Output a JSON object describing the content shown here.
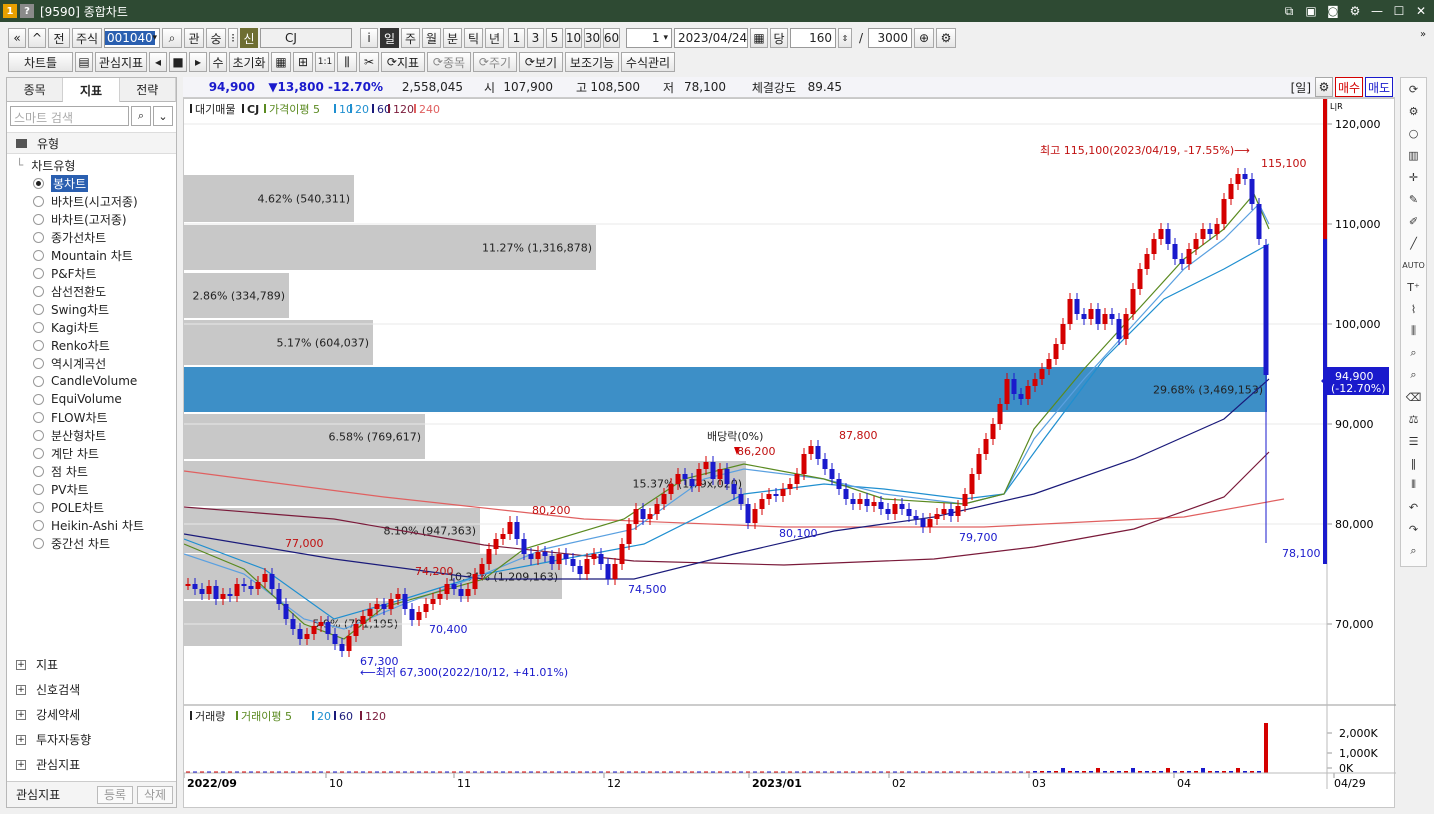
{
  "window": {
    "title": "[9590] 종합차트",
    "badge1": "1",
    "badge2": "?"
  },
  "toolbar1": {
    "nav_first": "«",
    "nav_up": "^",
    "prev": "전",
    "market": "주식",
    "code": "001040",
    "mag": "⌕",
    "rel": "관",
    "sort": "숭",
    "sep": "⁝",
    "new_badge": "신",
    "name": "CJ",
    "info": "i",
    "periods": [
      "일",
      "주",
      "월",
      "분",
      "틱",
      "년"
    ],
    "mins": [
      "1",
      "3",
      "5",
      "10",
      "30",
      "60"
    ],
    "unit": "1",
    "date": "2023/04/24",
    "dang": "당",
    "count": "160",
    "slash": "/",
    "total": "3000"
  },
  "toolbar2": {
    "chart_type": "차트틀",
    "interest": "관심지표",
    "su": "수",
    "reset": "초기화",
    "bong": "1:1",
    "indicator": "지표",
    "item": "종목",
    "period_btn": "주기",
    "view": "보기",
    "aux": "보조기능",
    "formula": "수식관리"
  },
  "left": {
    "tabs": [
      "종목",
      "지표",
      "전략"
    ],
    "search_placeholder": "스마트 검색",
    "section": "유형",
    "group": "차트유형",
    "items": [
      "봉차트",
      "바차트(시고저종)",
      "바차트(고저종)",
      "종가선차트",
      "Mountain 차트",
      "P&F차트",
      "삼선전환도",
      "Swing차트",
      "Kagi차트",
      "Renko차트",
      "역시계곡선",
      "CandleVolume",
      "EquiVolume",
      "FLOW차트",
      "분산형차트",
      "계단 차트",
      "점 차트",
      "PV차트",
      "POLE차트",
      "Heikin-Ashi 차트",
      "중간선 차트"
    ],
    "bottom": [
      "지표",
      "신호검색",
      "강세약세",
      "투자자동향",
      "관심지표"
    ],
    "fav": "관심지표",
    "reg": "등록",
    "del": "삭제"
  },
  "quote": {
    "price": "94,900",
    "change": "▼13,800 -12.70%",
    "volume": "2,558,045",
    "open_l": "시",
    "open": "107,900",
    "high_l": "고",
    "high": "108,500",
    "low_l": "저",
    "low": "78,100",
    "str_l": "체결강도",
    "str": "89.45",
    "period_tag": "[일]",
    "buy": "매수",
    "sell": "매도"
  },
  "legend": {
    "vp": "대기매물",
    "name": "CJ",
    "ma": "가격이평 5",
    "m10": "10",
    "m20": "20",
    "m60": "60",
    "m120": "120",
    "m240": "240"
  },
  "vlegend": {
    "v": "거래량",
    "ma": "거래이평 5",
    "m20": "20",
    "m60": "60",
    "m120": "120"
  },
  "annot": {
    "high": "최고 115,100(2023/04/19, -17.55%)⟶",
    "high_val": "115,100",
    "low": "⟵최저 67,300(2022/10/12, +41.01%)",
    "low_val": "67,300",
    "div": "배당락(0%)",
    "p80200": "80,200",
    "p77000": "77,000",
    "p74200": "74,200",
    "p70400": "70,400",
    "p74500": "74,500",
    "p86200": "86,200",
    "p87800": "87,800",
    "p80100": "80,100",
    "p79700": "79,700",
    "p78100": "78,100",
    "cur": "94,900",
    "cur_pct": "(-12.70%)"
  },
  "yaxis": [
    "120,000",
    "110,000",
    "100,000",
    "90,000",
    "80,000",
    "70,000"
  ],
  "vaxis": [
    "2,000K",
    "1,000K",
    "0K"
  ],
  "xaxis": [
    "2022/09",
    "10",
    "11",
    "12",
    "2023/01",
    "02",
    "03",
    "04",
    "04/29"
  ],
  "volprofile": [
    {
      "t": "4.62% (540,311)",
      "w": 170
    },
    {
      "t": "11.27% (1,316,878)",
      "w": 412
    },
    {
      "t": "2.86% (334,789)",
      "w": 105
    },
    {
      "t": "5.17% (604,037)",
      "w": 189
    },
    {
      "t": "29.68% (3,469,153)",
      "w": 1083
    },
    {
      "t": "6.58% (769,617)",
      "w": 241
    },
    {
      "t": "15.37% (1,79x,020)",
      "w": 562
    },
    {
      "t": "8.10% (947,363)",
      "w": 296
    },
    {
      "t": "10.34% (1,209,163)",
      "w": 378
    },
    {
      "t": "5.9% (701,195)",
      "w": 218
    }
  ],
  "colors": {
    "up": "#d40000",
    "down": "#1a1acc",
    "band": "#3d8fc7"
  }
}
